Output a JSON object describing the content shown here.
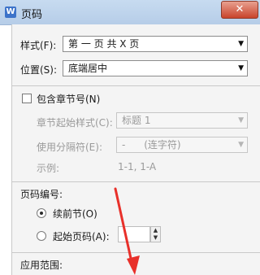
{
  "window": {
    "title": "页码",
    "app_icon": "W",
    "close_glyph": "✕"
  },
  "style": {
    "label": "样式(F):",
    "value": "第 一 页 共 X 页"
  },
  "position": {
    "label": "位置(S):",
    "value": "底端居中"
  },
  "include_chapter": {
    "label": "包含章节号(N)",
    "checked": false
  },
  "chapter_start_style": {
    "label": "章节起始样式(C):",
    "value": "标题 1"
  },
  "separator": {
    "label": "使用分隔符(E):",
    "value": "-      (连字符)"
  },
  "example": {
    "label": "示例:",
    "value": "1-1, 1-A"
  },
  "numbering": {
    "section_label": "页码编号:",
    "continue_label": "续前节(O)",
    "start_label": "起始页码(A):",
    "start_value": ""
  },
  "apply_scope": {
    "label": "应用范围:"
  },
  "colors": {
    "annotation_arrow": "#e8302a",
    "titlebar": "#c7dbf0"
  }
}
